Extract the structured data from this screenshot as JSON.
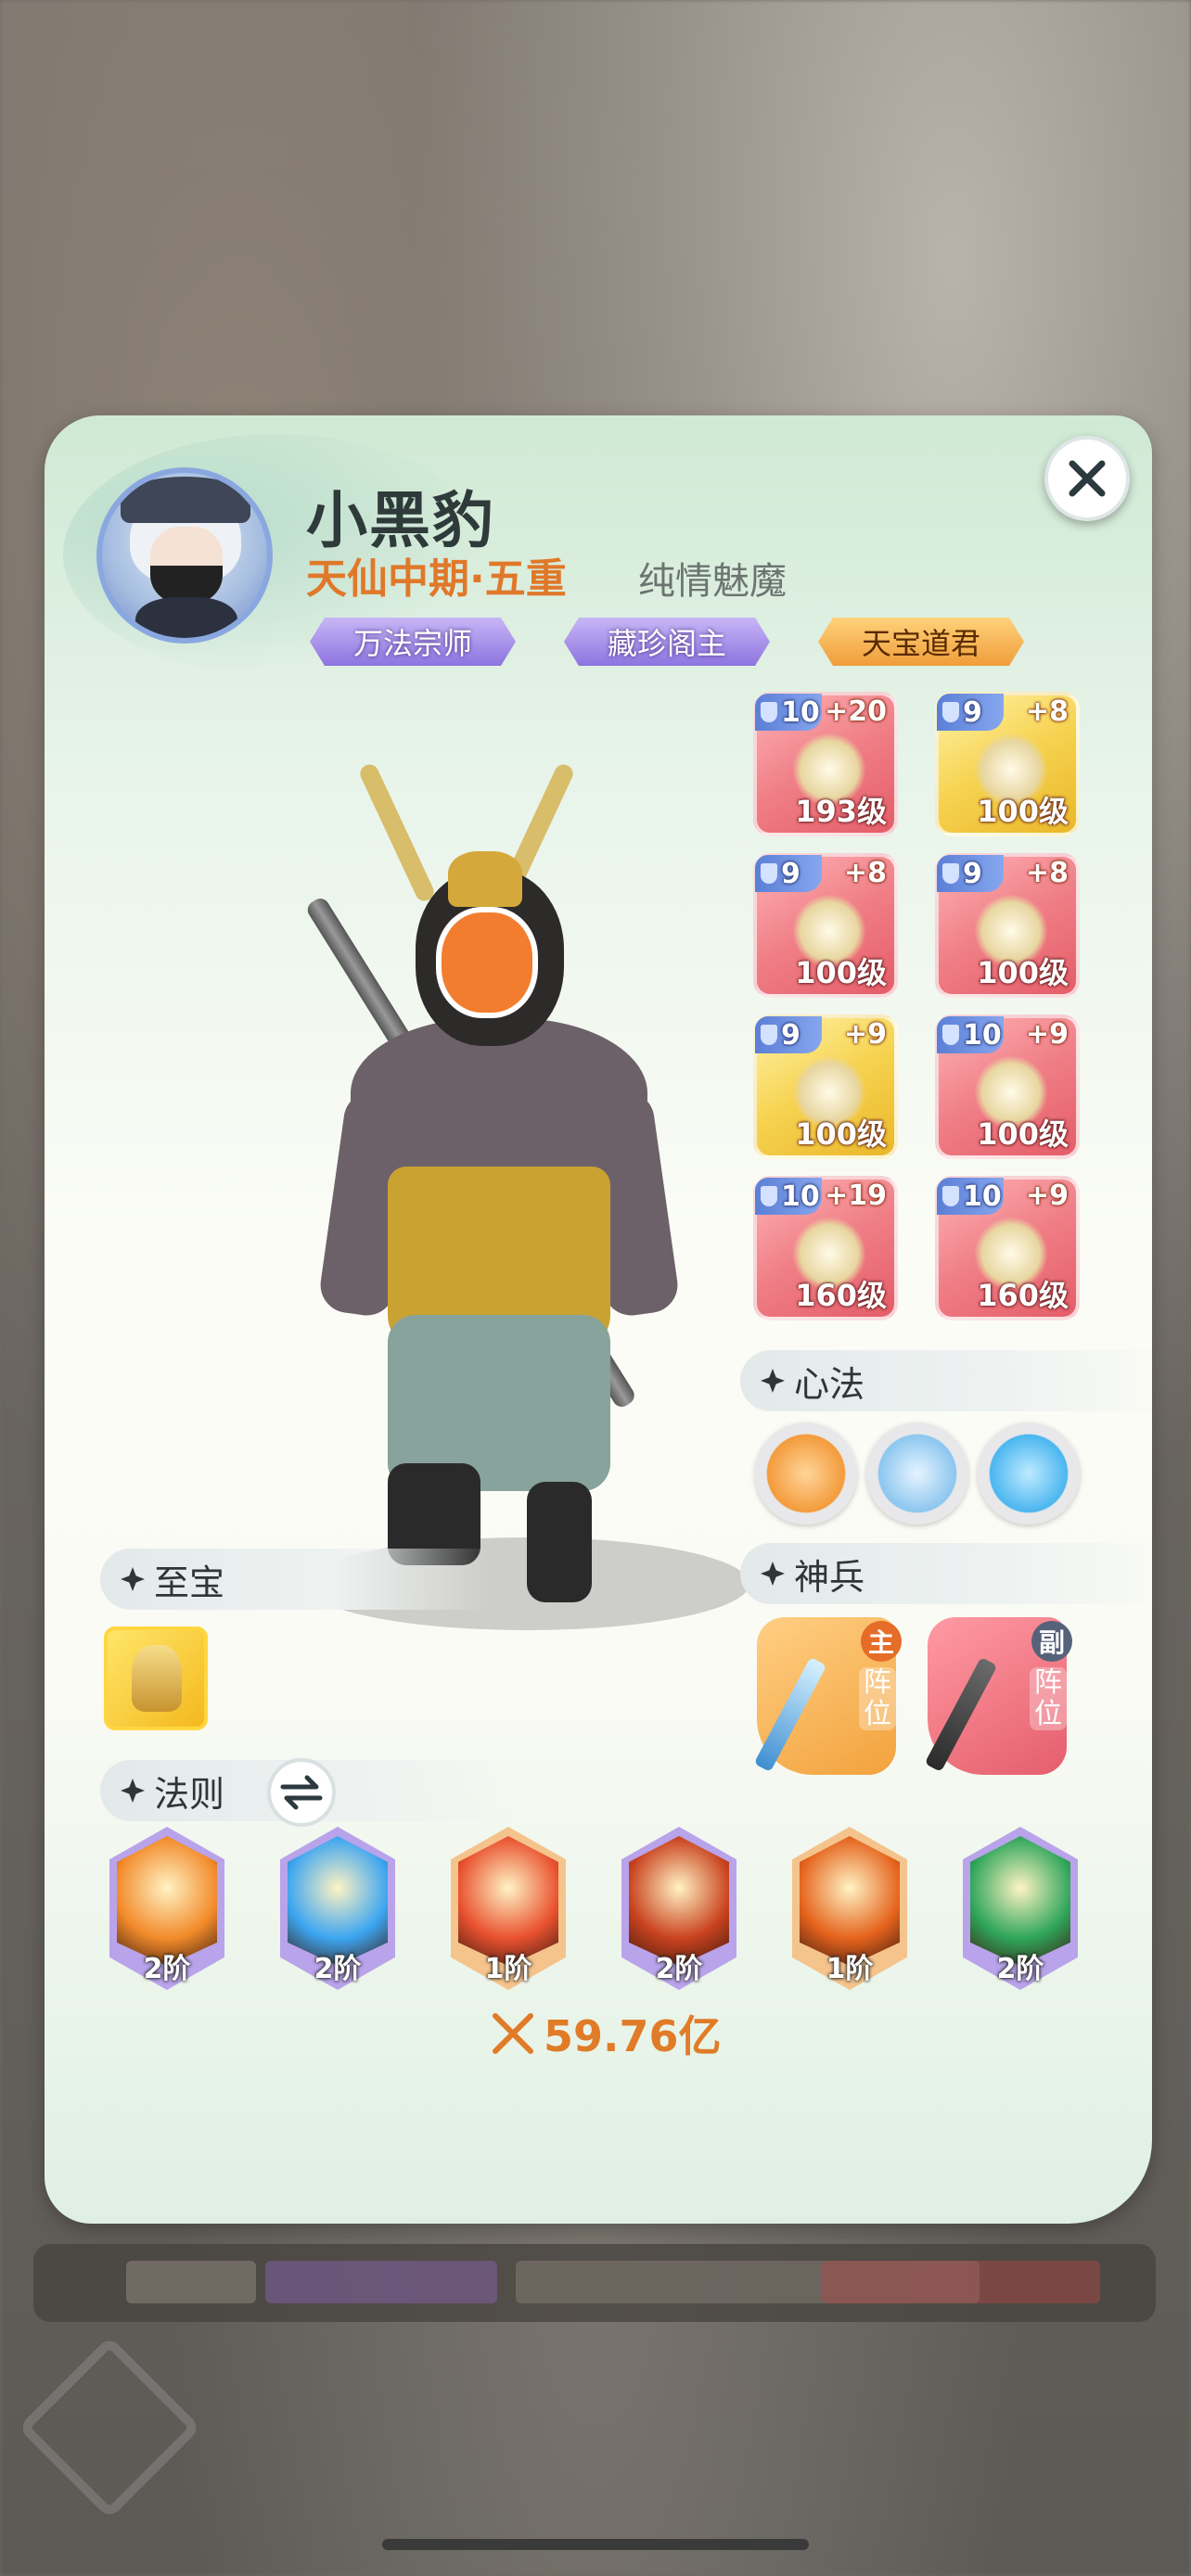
{
  "player": {
    "name": "小黑豹",
    "realm": "天仙中期·五重",
    "title": "纯情魅魔",
    "badges": [
      "万法宗师",
      "藏珍阁主",
      "天宝道君"
    ]
  },
  "equipment": [
    {
      "level": "10",
      "plus": "+20",
      "grade": "193级",
      "rarity": "red"
    },
    {
      "level": "9",
      "plus": "+8",
      "grade": "100级",
      "rarity": "gold"
    },
    {
      "level": "9",
      "plus": "+8",
      "grade": "100级",
      "rarity": "red"
    },
    {
      "level": "9",
      "plus": "+8",
      "grade": "100级",
      "rarity": "red"
    },
    {
      "level": "9",
      "plus": "+9",
      "grade": "100级",
      "rarity": "gold"
    },
    {
      "level": "10",
      "plus": "+9",
      "grade": "100级",
      "rarity": "red"
    },
    {
      "level": "10",
      "plus": "+19",
      "grade": "160级",
      "rarity": "red"
    },
    {
      "level": "10",
      "plus": "+9",
      "grade": "160级",
      "rarity": "red"
    }
  ],
  "sections": {
    "xinfa": "心法",
    "shenbing": "神兵",
    "zhibao": "至宝",
    "faze": "法则"
  },
  "weapons": [
    {
      "tag": "主",
      "position": "阵位",
      "color": "#f2a23c"
    },
    {
      "tag": "副",
      "position": "阵位",
      "color": "#e55e6c"
    }
  ],
  "rules": [
    {
      "stage": "2阶",
      "color": "#f28a2a",
      "frame": "#b9a3ea"
    },
    {
      "stage": "2阶",
      "color": "#3ca5f0",
      "frame": "#b9a3ea"
    },
    {
      "stage": "1阶",
      "color": "#e9512f",
      "frame": "#f4c48c"
    },
    {
      "stage": "2阶",
      "color": "#c9421e",
      "frame": "#b9a3ea"
    },
    {
      "stage": "1阶",
      "color": "#e5631c",
      "frame": "#f4c48c"
    },
    {
      "stage": "2阶",
      "color": "#2fa65a",
      "frame": "#b9a3ea"
    }
  ],
  "power": "59.76亿",
  "colors": {
    "accent_orange": "#e0782a",
    "panel_bg": "#fafbf4"
  }
}
